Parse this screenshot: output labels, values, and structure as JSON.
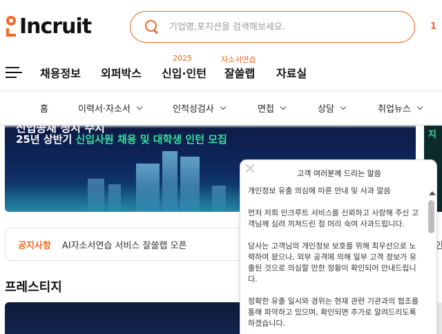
{
  "header": {
    "logo_text": "Incruit",
    "search_placeholder": "기업명,포지션을 검색해보세요.",
    "right_number": "1"
  },
  "nav": {
    "items": [
      {
        "label": "채용정보",
        "tag": ""
      },
      {
        "label": "외퍼박스",
        "tag": ""
      },
      {
        "label": "신입·인턴",
        "tag": "2025"
      },
      {
        "label": "잘쓸랩",
        "tag": "자소서연습"
      },
      {
        "label": "자료실",
        "tag": ""
      }
    ]
  },
  "subnav": {
    "items": [
      "홈",
      "이력서·자소서",
      "인적성검사",
      "면접",
      "상담",
      "취업뉴스"
    ]
  },
  "banner": {
    "top_text": "신입공채 정시 수시",
    "line_prefix": "25년 상반기 ",
    "line_highlight": "신입사원 채용 및 대학생 인턴 모집",
    "right_glyph": "지"
  },
  "notice": {
    "label": "공지사항",
    "text": "AI자소서연습 서비스 잘쓸랩 오픈",
    "right_text": "인"
  },
  "section": {
    "title": "프레스티지"
  },
  "popup": {
    "title": "고객 여러분께 드리는 말씀",
    "paragraphs": [
      "개인정보 유출 의심에 따른 안내 및 사과 말씀",
      "먼저 저희 인크루트 서비스를 신뢰하고 사랑해 주신 고객님께 심려 끼쳐드린 점 머리 숙여 사과드립니다.",
      "당사는 고객님의 개인정보 보호를 위해 최우선으로 노력하여 왔으나, 외부 공격에 의해 일부 고객 정보가 유출된 것으로 의심할 만한 정황이 확인되어 안내드립니다.",
      "정확한 유출 일시와 경위는 현재 관련 기관과의 협조를 통해 파악하고 있으며, 확인되면 추가로 알려드리도록 하겠습니다."
    ]
  },
  "colors": {
    "accent": "#f26722",
    "banner_highlight": "#35e0a0"
  }
}
